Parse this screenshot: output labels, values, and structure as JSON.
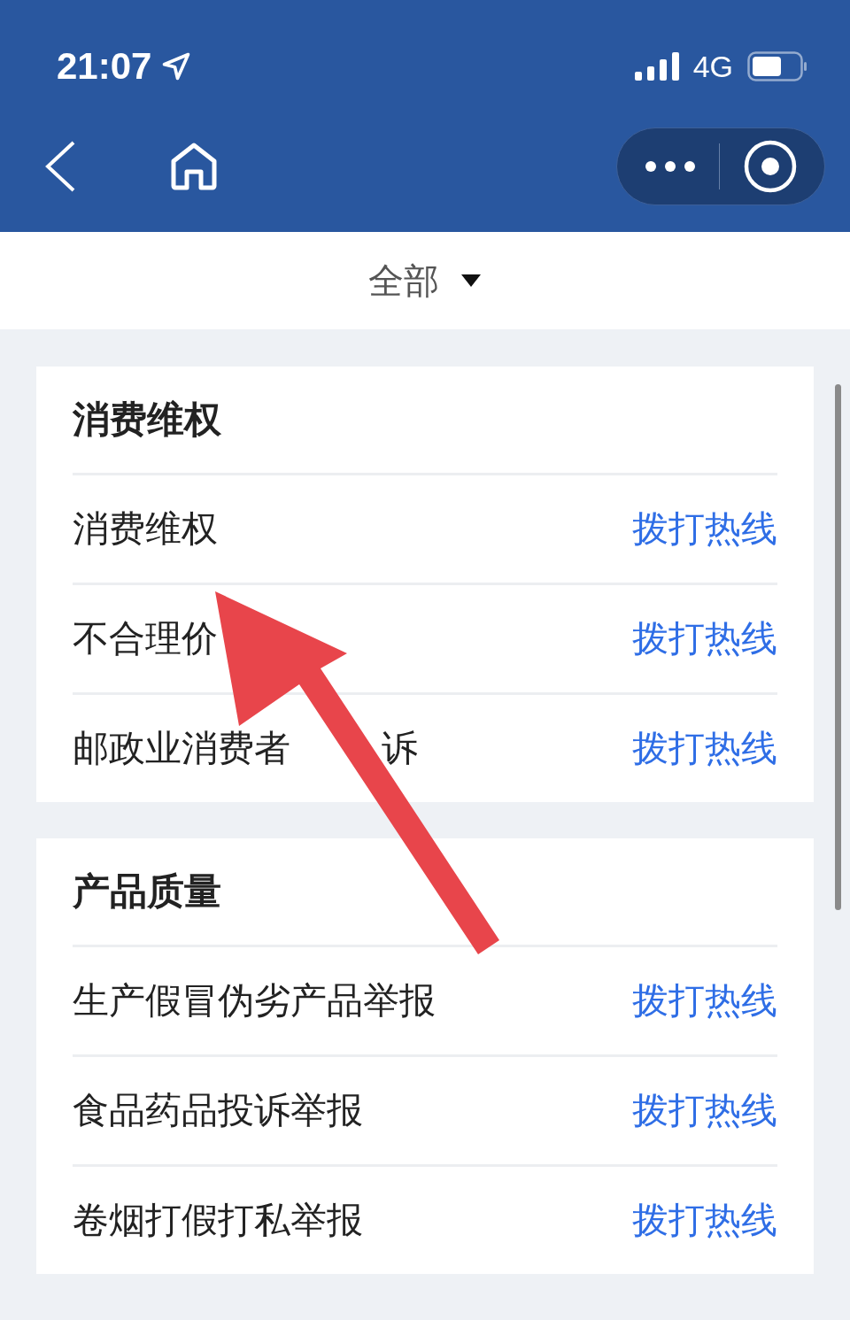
{
  "status_bar": {
    "time": "21:07",
    "network": "4G"
  },
  "filter": {
    "label": "全部"
  },
  "sections": [
    {
      "title": "消费维权",
      "items": [
        {
          "name": "消费维权",
          "action": "拨打热线"
        },
        {
          "name_parts": [
            "不合理价"
          ],
          "action": "拨打热线"
        },
        {
          "name_parts": [
            "邮政业消费者",
            "诉"
          ],
          "action": "拨打热线"
        }
      ]
    },
    {
      "title": "产品质量",
      "items": [
        {
          "name": "生产假冒伪劣产品举报",
          "action": "拨打热线"
        },
        {
          "name": "食品药品投诉举报",
          "action": "拨打热线"
        },
        {
          "name": "卷烟打假打私举报",
          "action": "拨打热线"
        }
      ]
    }
  ]
}
